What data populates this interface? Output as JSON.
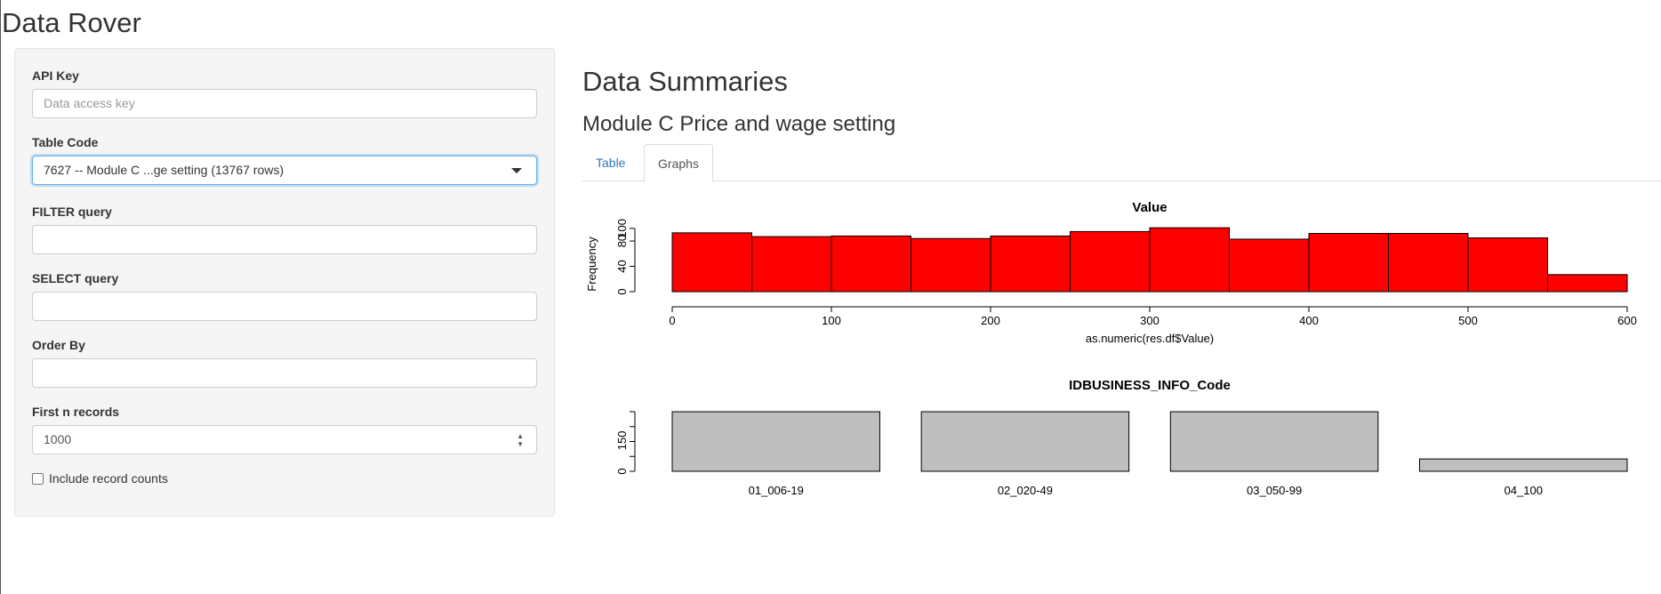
{
  "app": {
    "title": "Data Rover"
  },
  "sidebar": {
    "api_key": {
      "label": "API Key",
      "placeholder": "Data access key",
      "value": ""
    },
    "table_code": {
      "label": "Table Code",
      "value": "7627 -- Module C ...ge setting (13767 rows)"
    },
    "filter": {
      "label": "FILTER query",
      "value": ""
    },
    "select": {
      "label": "SELECT query",
      "value": ""
    },
    "order_by": {
      "label": "Order By",
      "value": ""
    },
    "first_n": {
      "label": "First n records",
      "value": "1000"
    },
    "record_counts": {
      "label": "Include record counts",
      "checked": false
    }
  },
  "main": {
    "heading": "Data Summaries",
    "subheading": "Module C Price and wage setting",
    "tabs": [
      {
        "label": "Table",
        "active": false
      },
      {
        "label": "Graphs",
        "active": true
      }
    ]
  },
  "colors": {
    "hist_fill": "#ff0000",
    "bar_fill": "#bebebe",
    "link": "#337ab7"
  },
  "chart_data": [
    {
      "type": "bar",
      "title": "Value",
      "xlabel": "as.numeric(res.df$Value)",
      "ylabel": "Frequency",
      "bins": [
        [
          0,
          50
        ],
        [
          50,
          100
        ],
        [
          100,
          150
        ],
        [
          150,
          200
        ],
        [
          200,
          250
        ],
        [
          250,
          300
        ],
        [
          300,
          350
        ],
        [
          350,
          400
        ],
        [
          400,
          450
        ],
        [
          450,
          500
        ],
        [
          500,
          550
        ],
        [
          550,
          600
        ]
      ],
      "values": [
        93,
        87,
        88,
        84,
        88,
        95,
        101,
        83,
        92,
        92,
        85,
        27
      ],
      "xticks": [
        0,
        100,
        200,
        300,
        400,
        500,
        600
      ],
      "yticks": [
        0,
        40,
        80,
        100
      ],
      "xlim": [
        0,
        600
      ],
      "ylim": [
        0,
        104
      ]
    },
    {
      "type": "bar",
      "title": "IDBUSINESS_INFO_Code",
      "categories": [
        "01_006-19",
        "02_020-49",
        "03_050-99",
        "04_100"
      ],
      "values": [
        290,
        290,
        290,
        60
      ],
      "yticks": [
        0,
        150
      ],
      "ylim": [
        0,
        290
      ]
    }
  ]
}
